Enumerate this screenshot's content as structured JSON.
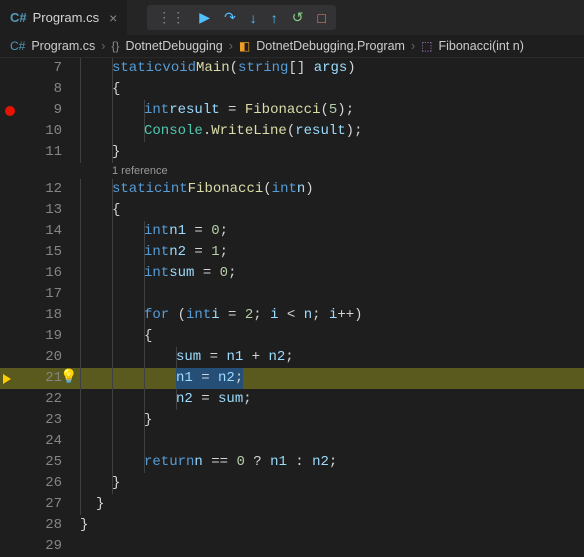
{
  "tab": {
    "label": "Program.cs",
    "icon": "C#"
  },
  "debug": {
    "handle": "⋮⋮",
    "continue": "▶",
    "stepover": "↷",
    "stepinto": "↓",
    "stepout": "↑",
    "restart": "↺",
    "stop": "□"
  },
  "breadcrumbs": {
    "file": "Program.cs",
    "namespace": "DotnetDebugging",
    "class": "DotnetDebugging.Program",
    "method": "Fibonacci(int n)"
  },
  "codelens": {
    "references": "1 reference"
  },
  "lines": {
    "l7": "        static void Main(string[] args)",
    "l8": "        {",
    "l9": "            int result = Fibonacci(5);",
    "l10": "            Console.WriteLine(result);",
    "l11": "        }",
    "l12": "        static int Fibonacci(int n)",
    "l13": "        {",
    "l14": "            int n1 = 0;",
    "l15": "            int n2 = 1;",
    "l16": "            int sum = 0;",
    "l17": "",
    "l18": "            for (int i = 2; i < n; i++)",
    "l19": "            {",
    "l20": "                sum = n1 + n2;",
    "l21": "                n1 = n2;",
    "l22": "                n2 = sum;",
    "l23": "            }",
    "l24": "",
    "l25": "            return n == 0 ? n1 : n2;",
    "l26": "        }",
    "l27": "    }",
    "l28": "}",
    "l29": ""
  },
  "lineNumbers": [
    "7",
    "8",
    "9",
    "10",
    "11",
    "",
    "12",
    "13",
    "14",
    "15",
    "16",
    "17",
    "18",
    "19",
    "20",
    "21",
    "22",
    "23",
    "24",
    "25",
    "26",
    "27",
    "28",
    "29"
  ]
}
